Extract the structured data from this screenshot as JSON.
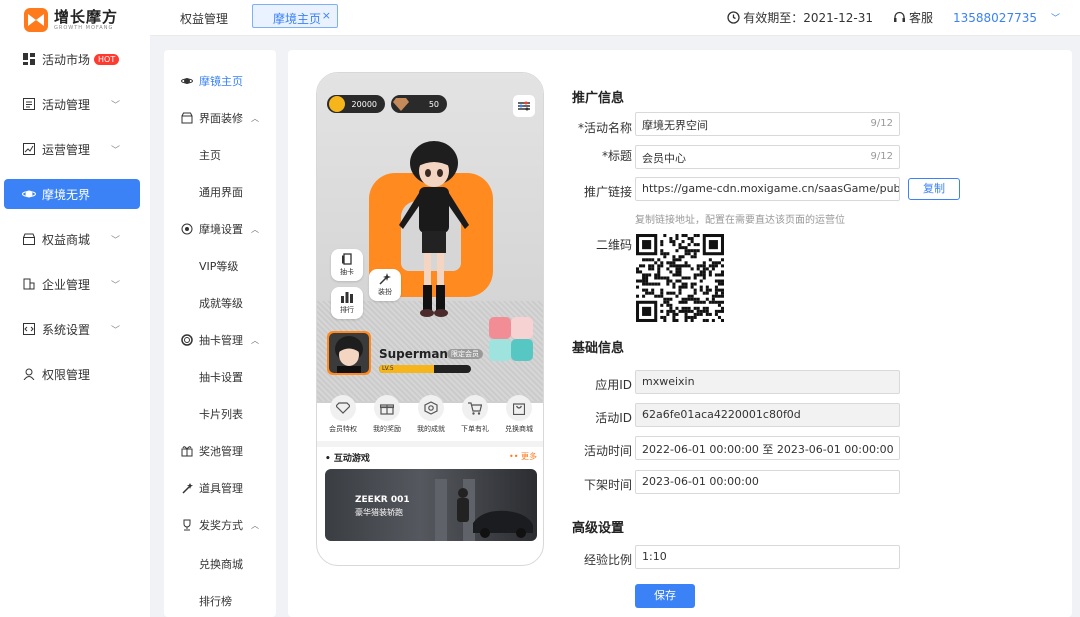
{
  "brand": {
    "name_cn": "增长摩方",
    "name_en": "GROWTH MOFANG",
    "color": "#ff7a1a"
  },
  "sidebar": {
    "items": [
      {
        "label": "活动市场",
        "badge": "HOT",
        "icon": "grid-icon"
      },
      {
        "label": "活动管理",
        "icon": "list-icon"
      },
      {
        "label": "运营管理",
        "icon": "chart-icon"
      },
      {
        "label": "摩境无界",
        "icon": "planet-icon",
        "active": true
      },
      {
        "label": "权益商城",
        "icon": "store-icon"
      },
      {
        "label": "企业管理",
        "icon": "building-icon"
      },
      {
        "label": "系统设置",
        "icon": "code-icon"
      },
      {
        "label": "权限管理",
        "icon": "user-icon"
      }
    ]
  },
  "topbar": {
    "title": "权益管理",
    "tab": "摩境主页",
    "tab_close": "×",
    "expiry": "有效期至：2021-12-31",
    "service": "客服",
    "phone": "13588027735"
  },
  "submenu": {
    "items": [
      {
        "label": "摩镜主页",
        "type": "top",
        "active": true,
        "icon": "planet-icon"
      },
      {
        "label": "界面装修",
        "type": "group",
        "icon": "shop-icon"
      },
      {
        "label": "主页",
        "type": "child"
      },
      {
        "label": "通用界面",
        "type": "child"
      },
      {
        "label": "摩境设置",
        "type": "group",
        "icon": "target-icon"
      },
      {
        "label": "VIP等级",
        "type": "child"
      },
      {
        "label": "成就等级",
        "type": "child"
      },
      {
        "label": "抽卡管理",
        "type": "group",
        "icon": "circle-icon"
      },
      {
        "label": "抽卡设置",
        "type": "child"
      },
      {
        "label": "卡片列表",
        "type": "child"
      },
      {
        "label": "奖池管理",
        "type": "top",
        "icon": "gift-icon"
      },
      {
        "label": "道具管理",
        "type": "top",
        "icon": "magic-icon"
      },
      {
        "label": "发奖方式",
        "type": "group",
        "icon": "trophy-icon"
      },
      {
        "label": "兑换商城",
        "type": "child"
      },
      {
        "label": "排行榜",
        "type": "child"
      }
    ]
  },
  "phone": {
    "coins": "20000",
    "gems": "50",
    "btn_draw": "抽卡",
    "btn_outfit": "装扮",
    "btn_rank": "排行",
    "username": "Superman",
    "user_tag": "限定会员",
    "level": "LV.5",
    "level_progress": 0.6,
    "quick": [
      "会员特权",
      "我的奖励",
      "我的成就",
      "下单有礼",
      "兑换商城"
    ],
    "games_title": "• 互动游戏",
    "games_more": "•• 更多",
    "banner_line1": "ZEEKR 001",
    "banner_line2": "豪华猎装轿跑"
  },
  "promo": {
    "title": "推广信息",
    "name_label": "*活动名称",
    "name_value": "摩境无界空间",
    "name_count": "9/12",
    "title_label": "*标题",
    "title_value": "会员中心",
    "title_count": "9/12",
    "link_label": "推广链接",
    "link_value": "https://game-cdn.moxigame.cn/saasGame/public-pu",
    "copy": "复制",
    "hint": "复制链接地址，配置在需要直达该页面的运营位",
    "qr_label": "二维码"
  },
  "basic": {
    "title": "基础信息",
    "app_label": "应用ID",
    "app_value": "mxweixin",
    "act_label": "活动ID",
    "act_value": "62a6fe01aca4220001c80f0d",
    "time_label": "活动时间",
    "time_value": "2022-06-01 00:00:00  至  2023-06-01 00:00:00",
    "off_label": "下架时间",
    "off_value": "2023-06-01 00:00:00"
  },
  "advanced": {
    "title": "高级设置",
    "exp_label": "经验比例",
    "exp_value": "1:10"
  },
  "save": "保存",
  "accent": "#3a82f6"
}
